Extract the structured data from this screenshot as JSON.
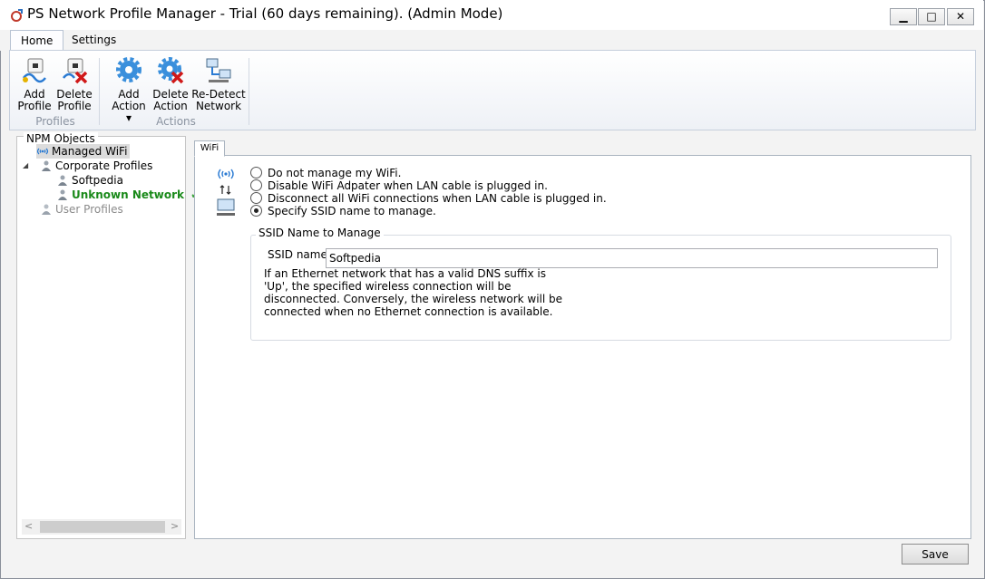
{
  "window": {
    "title": "PS Network Profile Manager - Trial (60 days remaining). (Admin Mode)",
    "minimize_glyph": "▁",
    "maximize_glyph": "□",
    "close_glyph": "✕"
  },
  "ribbon": {
    "tabs": [
      {
        "label": "Home",
        "active": true
      },
      {
        "label": "Settings",
        "active": false
      }
    ],
    "groups": [
      {
        "label": "Profiles",
        "buttons": [
          {
            "line1": "Add",
            "line2": "Profile"
          },
          {
            "line1": "Delete",
            "line2": "Profile"
          }
        ]
      },
      {
        "label": "Actions",
        "buttons": [
          {
            "line1": "Add",
            "line2": "Action ▾"
          },
          {
            "line1": "Delete",
            "line2": "Action"
          },
          {
            "line1": "Re-Detect",
            "line2": "Network"
          }
        ]
      }
    ]
  },
  "tree": {
    "caption": "NPM Objects",
    "items": [
      {
        "label": "Managed WiFi",
        "icon": "wifi-icon"
      },
      {
        "label": "Corporate Profiles",
        "icon": "user-group-icon",
        "expander": "◢"
      },
      {
        "label": "Softpedia",
        "icon": "profile-icon"
      },
      {
        "label": "Unknown Network",
        "icon": "profile-icon",
        "check": "✔"
      },
      {
        "label": "User Profiles",
        "icon": "user-group-icon"
      }
    ],
    "scroll_left": "<",
    "scroll_right": ">"
  },
  "panel": {
    "tab": "WiFi",
    "options": [
      {
        "label": "Do not manage my WiFi.",
        "selected": false
      },
      {
        "label": "Disable WiFi Adpater when LAN cable is plugged in.",
        "selected": false
      },
      {
        "label": "Disconnect all WiFi connections when LAN cable is plugged in.",
        "selected": false
      },
      {
        "label": "Specify SSID name to manage.",
        "selected": true
      }
    ],
    "group_title": "SSID Name to Manage",
    "ssid_label": "SSID name",
    "ssid_value": "Softpedia",
    "description": "If an Ethernet network that has a valid DNS suffix is 'Up', the specified wireless connection will be disconnected. Conversely, the wireless network will be connected when no Ethernet connection is available."
  },
  "footer": {
    "save_label": "Save"
  },
  "colors": {
    "accent_green": "#1a8a1a",
    "ribbon_border": "#c6cfdc"
  }
}
